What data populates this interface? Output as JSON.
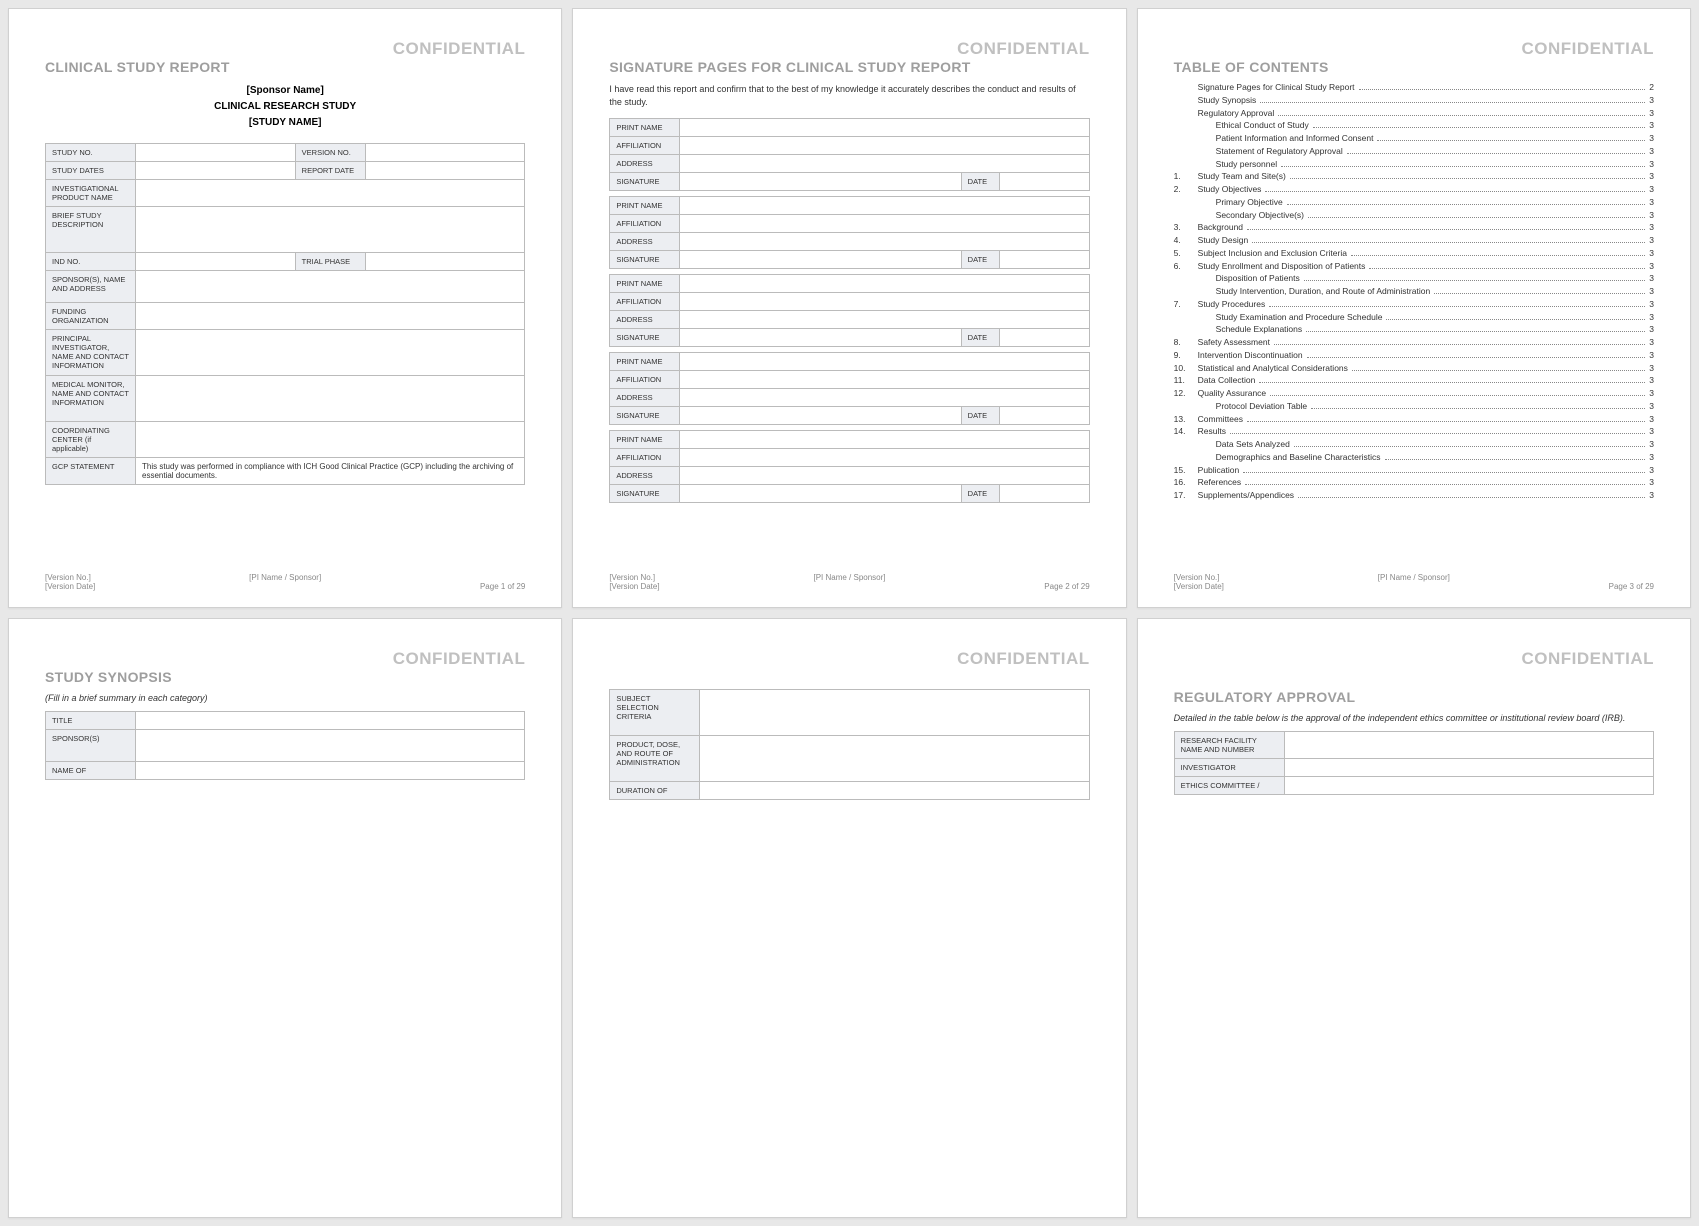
{
  "confidential": "CONFIDENTIAL",
  "footer": {
    "version_no": "[Version No.]",
    "version_date": "[Version Date]",
    "pi_sponsor": "[PI Name / Sponsor]"
  },
  "page1": {
    "title": "CLINICAL STUDY REPORT",
    "sponsor": "[Sponsor Name]",
    "study_label": "CLINICAL RESEARCH STUDY",
    "study_name": "[STUDY NAME]",
    "rows": {
      "study_no": "STUDY NO.",
      "version_no": "VERSION NO.",
      "study_dates": "STUDY DATES",
      "report_date": "REPORT DATE",
      "product_name": "INVESTIGATIONAL PRODUCT NAME",
      "brief_desc": "BRIEF STUDY DESCRIPTION",
      "ind_no": "IND NO.",
      "trial_phase": "TRIAL PHASE",
      "sponsors": "SPONSOR(S), NAME AND ADDRESS",
      "funding": "FUNDING ORGANIZATION",
      "pi": "PRINCIPAL INVESTIGATOR, NAME AND CONTACT INFORMATION",
      "medical_monitor": "MEDICAL MONITOR, NAME AND CONTACT INFORMATION",
      "coord": "COORDINATING CENTER (if applicable)",
      "gcp_label": "GCP STATEMENT",
      "gcp_text": "This study was performed in compliance with ICH Good Clinical Practice (GCP) including the archiving of essential documents."
    },
    "page_num": "Page 1 of 29"
  },
  "page2": {
    "title": "SIGNATURE PAGES FOR CLINICAL STUDY REPORT",
    "intro": "I have read this report and confirm that to the best of my knowledge it accurately describes the conduct and results of the study.",
    "labels": {
      "print_name": "PRINT NAME",
      "affiliation": "AFFILIATION",
      "address": "ADDRESS",
      "signature": "SIGNATURE",
      "date": "DATE"
    },
    "page_num": "Page 2 of 29"
  },
  "page3": {
    "title": "TABLE OF CONTENTS",
    "items": [
      {
        "num": "",
        "label": "Signature Pages for Clinical Study Report",
        "page": "2",
        "sub": false
      },
      {
        "num": "",
        "label": "Study Synopsis",
        "page": "3",
        "sub": false
      },
      {
        "num": "",
        "label": "Regulatory Approval",
        "page": "3",
        "sub": false
      },
      {
        "num": "",
        "label": "Ethical Conduct of Study",
        "page": "3",
        "sub": true
      },
      {
        "num": "",
        "label": "Patient Information and Informed Consent",
        "page": "3",
        "sub": true
      },
      {
        "num": "",
        "label": "Statement of Regulatory Approval",
        "page": "3",
        "sub": true
      },
      {
        "num": "",
        "label": "Study personnel",
        "page": "3",
        "sub": true
      },
      {
        "num": "1.",
        "label": "Study Team and Site(s)",
        "page": "3",
        "sub": false
      },
      {
        "num": "2.",
        "label": "Study Objectives",
        "page": "3",
        "sub": false
      },
      {
        "num": "",
        "label": "Primary Objective",
        "page": "3",
        "sub": true
      },
      {
        "num": "",
        "label": "Secondary Objective(s)",
        "page": "3",
        "sub": true
      },
      {
        "num": "3.",
        "label": "Background",
        "page": "3",
        "sub": false
      },
      {
        "num": "4.",
        "label": "Study Design",
        "page": "3",
        "sub": false
      },
      {
        "num": "5.",
        "label": "Subject Inclusion and Exclusion Criteria",
        "page": "3",
        "sub": false
      },
      {
        "num": "6.",
        "label": "Study Enrollment and Disposition of Patients",
        "page": "3",
        "sub": false
      },
      {
        "num": "",
        "label": "Disposition of Patients",
        "page": "3",
        "sub": true
      },
      {
        "num": "",
        "label": "Study Intervention, Duration, and Route of Administration",
        "page": "3",
        "sub": true
      },
      {
        "num": "7.",
        "label": "Study Procedures",
        "page": "3",
        "sub": false
      },
      {
        "num": "",
        "label": "Study Examination and Procedure Schedule",
        "page": "3",
        "sub": true
      },
      {
        "num": "",
        "label": "Schedule Explanations",
        "page": "3",
        "sub": true
      },
      {
        "num": "8.",
        "label": "Safety Assessment",
        "page": "3",
        "sub": false
      },
      {
        "num": "9.",
        "label": "Intervention Discontinuation",
        "page": "3",
        "sub": false
      },
      {
        "num": "10.",
        "label": "Statistical and Analytical Considerations",
        "page": "3",
        "sub": false
      },
      {
        "num": "11.",
        "label": "Data Collection",
        "page": "3",
        "sub": false
      },
      {
        "num": "12.",
        "label": "Quality Assurance",
        "page": "3",
        "sub": false
      },
      {
        "num": "",
        "label": "Protocol Deviation Table",
        "page": "3",
        "sub": true
      },
      {
        "num": "13.",
        "label": "Committees",
        "page": "3",
        "sub": false
      },
      {
        "num": "14.",
        "label": "Results",
        "page": "3",
        "sub": false
      },
      {
        "num": "",
        "label": "Data Sets Analyzed",
        "page": "3",
        "sub": true
      },
      {
        "num": "",
        "label": "Demographics and Baseline Characteristics",
        "page": "3",
        "sub": true
      },
      {
        "num": "15.",
        "label": "Publication",
        "page": "3",
        "sub": false
      },
      {
        "num": "16.",
        "label": "References",
        "page": "3",
        "sub": false
      },
      {
        "num": "17.",
        "label": "Supplements/Appendices",
        "page": "3",
        "sub": false
      }
    ],
    "page_num": "Page 3 of 29"
  },
  "page4": {
    "title": "STUDY SYNOPSIS",
    "note": "(Fill in a brief summary in each category)",
    "rows": {
      "title": "TITLE",
      "sponsors": "SPONSOR(S)",
      "name_of": "NAME OF"
    }
  },
  "page5": {
    "rows": {
      "subject_selection": "SUBJECT SELECTION CRITERIA",
      "product_dose": "PRODUCT, DOSE, AND ROUTE OF ADMINISTRATION",
      "duration": "DURATION OF"
    }
  },
  "page6": {
    "title": "REGULATORY APPROVAL",
    "note": "Detailed in the table below is the approval of the independent ethics committee or institutional review board (IRB).",
    "rows": {
      "research_facility": "RESEARCH FACILITY NAME AND NUMBER",
      "investigator": "INVESTIGATOR",
      "ethics": "ETHICS COMMITTEE /"
    }
  }
}
